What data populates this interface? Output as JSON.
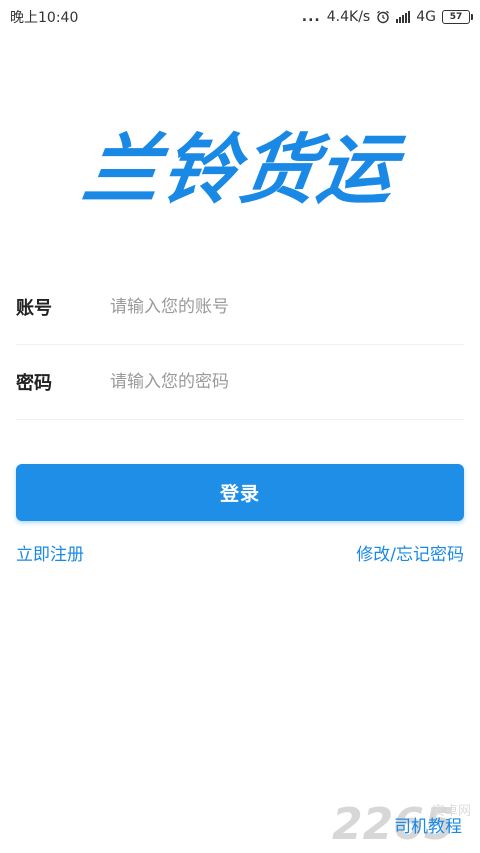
{
  "status_bar": {
    "time": "晚上10:40",
    "dots": "...",
    "speed": "4.4K/s",
    "network": "4G",
    "battery": "57",
    "icons": [
      "alarm-icon",
      "signal-icon",
      "battery-icon"
    ]
  },
  "logo": {
    "text": "兰铃货运",
    "color": "#1a89e6"
  },
  "form": {
    "account_label": "账号",
    "account_placeholder": "请输入您的账号",
    "account_value": "",
    "password_label": "密码",
    "password_placeholder": "请输入您的密码",
    "password_value": ""
  },
  "login_button": {
    "label": "登录",
    "color": "#1f8ee6"
  },
  "links": {
    "register": "立即注册",
    "forgot": "修改/忘记密码"
  },
  "tutorial": {
    "label": "司机教程"
  },
  "watermark": {
    "number": "2265",
    "text": "安卓网"
  }
}
